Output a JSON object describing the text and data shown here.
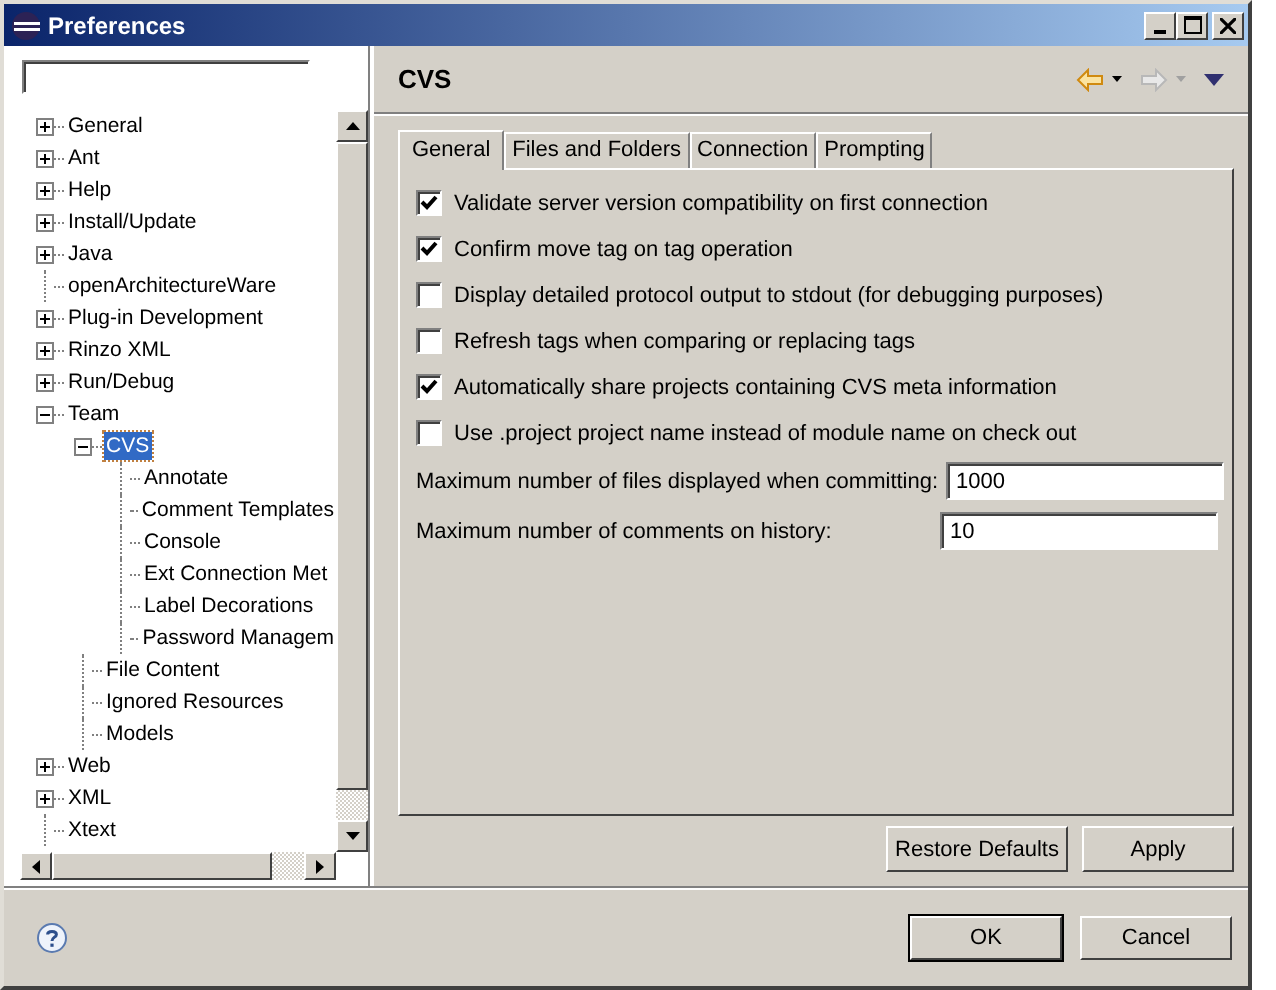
{
  "window": {
    "title": "Preferences"
  },
  "tree": [
    {
      "label": "General",
      "kind": "group",
      "expanded": false,
      "selected": false
    },
    {
      "label": "Ant",
      "kind": "group",
      "expanded": false,
      "selected": false
    },
    {
      "label": "Help",
      "kind": "group",
      "expanded": false,
      "selected": false
    },
    {
      "label": "Install/Update",
      "kind": "group",
      "expanded": false,
      "selected": false
    },
    {
      "label": "Java",
      "kind": "group",
      "expanded": false,
      "selected": false
    },
    {
      "label": "openArchitectureWare",
      "kind": "page",
      "selected": false
    },
    {
      "label": "Plug-in Development",
      "kind": "group",
      "expanded": false,
      "selected": false
    },
    {
      "label": "Rinzo XML",
      "kind": "group",
      "expanded": false,
      "selected": false
    },
    {
      "label": "Run/Debug",
      "kind": "group",
      "expanded": false,
      "selected": false
    },
    {
      "label": "Team",
      "kind": "group",
      "expanded": true,
      "selected": false,
      "children": [
        {
          "label": "CVS",
          "kind": "group",
          "expanded": true,
          "selected": true,
          "children": [
            {
              "label": "Annotate",
              "kind": "page",
              "selected": false
            },
            {
              "label": "Comment Templates",
              "kind": "page",
              "selected": false
            },
            {
              "label": "Console",
              "kind": "page",
              "selected": false
            },
            {
              "label": "Ext Connection Met",
              "kind": "page",
              "selected": false
            },
            {
              "label": "Label Decorations",
              "kind": "page",
              "selected": false
            },
            {
              "label": "Password Managem",
              "kind": "page",
              "selected": false
            }
          ]
        },
        {
          "label": "File Content",
          "kind": "page",
          "selected": false
        },
        {
          "label": "Ignored Resources",
          "kind": "page",
          "selected": false
        },
        {
          "label": "Models",
          "kind": "page",
          "selected": false
        }
      ]
    },
    {
      "label": "Web",
      "kind": "group",
      "expanded": false,
      "selected": false
    },
    {
      "label": "XML",
      "kind": "group",
      "expanded": false,
      "selected": false
    },
    {
      "label": "Xtext",
      "kind": "page",
      "selected": false
    }
  ],
  "page": {
    "title": "CVS",
    "back": {
      "disabled": false
    },
    "forward": {
      "disabled": true
    }
  },
  "tabs": [
    {
      "label": "General",
      "selected": true
    },
    {
      "label": "Files and Folders",
      "selected": false
    },
    {
      "label": "Connection",
      "selected": false
    },
    {
      "label": "Prompting",
      "selected": false
    }
  ],
  "options": [
    {
      "label": "Validate server version compatibility on first connection",
      "checked": true
    },
    {
      "label": "Confirm move tag on tag operation",
      "checked": true
    },
    {
      "label": "Display detailed protocol output to stdout (for debugging purposes)",
      "checked": false
    },
    {
      "label": "Refresh tags when comparing or replacing tags",
      "checked": false
    },
    {
      "label": "Automatically share projects containing CVS meta information",
      "checked": true
    },
    {
      "label": "Use .project project name instead of module name on check out",
      "checked": false
    }
  ],
  "fields": [
    {
      "label": "Maximum number of files displayed when committing:",
      "value": "1000"
    },
    {
      "label": "Maximum number of comments on history:",
      "value": "10"
    }
  ],
  "page_buttons": [
    "Restore Defaults",
    "Apply"
  ],
  "dialog_buttons": [
    {
      "label": "OK",
      "default": true
    },
    {
      "label": "Cancel",
      "default": false
    }
  ]
}
